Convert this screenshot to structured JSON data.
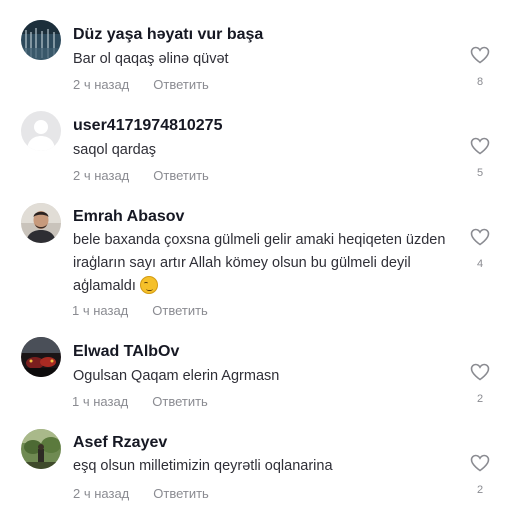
{
  "comments": [
    {
      "author": "Düz yaşa həyatı vur başa",
      "text": "Bar ol qaqaş əlinə qüvət",
      "time": "2 ч назад",
      "reply_label": "Ответить",
      "likes": "8"
    },
    {
      "author": "user4171974810275",
      "text": "saqol qardaş",
      "time": "2 ч назад",
      "reply_label": "Ответить",
      "likes": "5"
    },
    {
      "author": "Emrah Abasov",
      "text": "bele baxanda çoxsna gülmeli gelir amaki heqiqeten üzden iraģların sayı artır Allah kömey olsun bu gülmeli deyil aģlamaldı",
      "time": "1 ч назад",
      "reply_label": "Ответить",
      "likes": "4"
    },
    {
      "author": "Elwad TAlbOv",
      "text": "Ogulsan Qaqam elerin Agrmasn",
      "time": "1 ч назад",
      "reply_label": "Ответить",
      "likes": "2"
    },
    {
      "author": "Asef Rzayev",
      "text": "eşq olsun milletimizin qeyrətli oqlanarina",
      "time": "2 ч назад",
      "reply_label": "Ответить",
      "likes": "2"
    }
  ],
  "icons": {
    "like": "heart-outline-icon",
    "emoji": "smirking-face-emoji"
  },
  "colors": {
    "text_primary": "#161823",
    "text_secondary": "#8a8b91"
  }
}
